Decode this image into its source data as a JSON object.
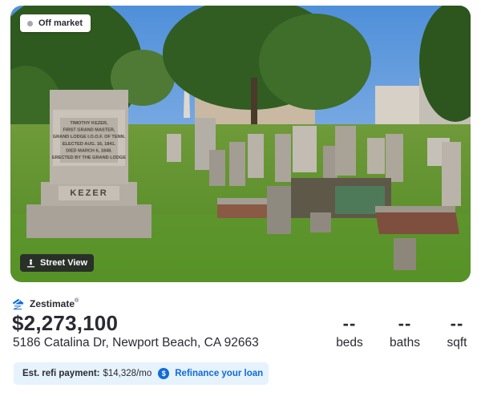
{
  "photo": {
    "badge": "Off market",
    "street_view_label": "Street View",
    "monument_inscription": [
      "TIMOTHY KEZER,",
      "FIRST GRAND MASTER,",
      "GRAND LODGE I.O.O.F. OF TENN.",
      "ELECTED AUG. 16, 1841.",
      "DIED MARCH 6, 1848.",
      "ERECTED BY THE GRAND LODGE"
    ],
    "monument_name": "KEZER"
  },
  "zestimate": {
    "label": "Zestimate",
    "mark": "®",
    "value": "$2,273,100"
  },
  "address": "5186 Catalina Dr, Newport Beach, CA 92663",
  "stats": {
    "beds": {
      "value": "--",
      "label": "beds"
    },
    "baths": {
      "value": "--",
      "label": "baths"
    },
    "sqft": {
      "value": "--",
      "label": "sqft"
    }
  },
  "refi": {
    "label": "Est. refi payment:",
    "amount": "$14,328/mo",
    "icon": "dollar-circle-icon",
    "link": "Refinance your loan"
  },
  "colors": {
    "brand_blue": "#0f6bd8",
    "refi_bg": "#e6f2fc",
    "text": "#2a2a33"
  }
}
